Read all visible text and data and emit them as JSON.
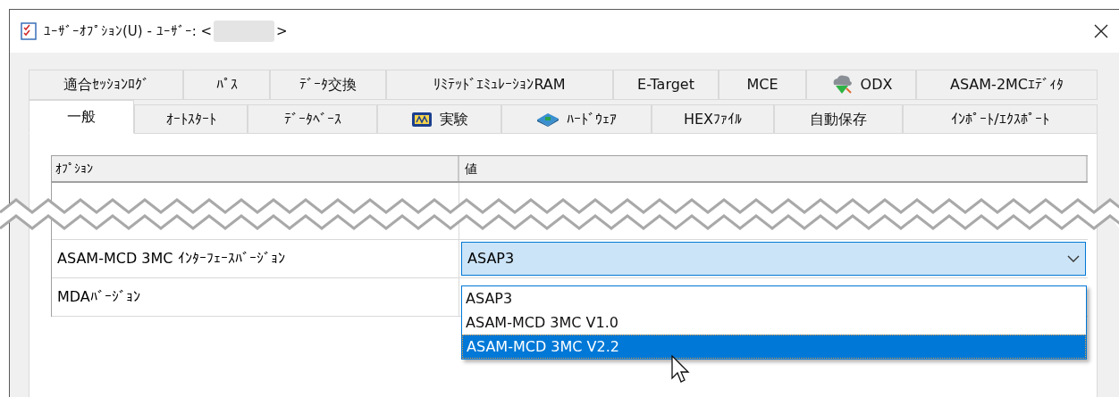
{
  "window": {
    "title_prefix": "ﾕｰｻﾞｰｵﾌﾟｼｮﾝ(U) - ﾕｰｻﾞｰ: <",
    "title_suffix": ">"
  },
  "tabs_back": [
    {
      "label": "適合ｾｯｼｮﾝﾛｸﾞ",
      "kind": "text",
      "selected": false
    },
    {
      "label": "ﾊﾟｽ",
      "kind": "text",
      "selected": false
    },
    {
      "label": "ﾃﾞｰﾀ交換",
      "kind": "text",
      "selected": false
    },
    {
      "label": "ﾘﾐﾃｯﾄﾞｴﾐｭﾚｰｼｮﾝRAM",
      "kind": "text",
      "selected": false
    },
    {
      "label": "E-Target",
      "kind": "text",
      "selected": false
    },
    {
      "label": "MCE",
      "kind": "text",
      "selected": false
    },
    {
      "label": "ODX",
      "kind": "odx",
      "selected": false
    },
    {
      "label": "ASAM-2MCｴﾃﾞｨﾀ",
      "kind": "text",
      "selected": false
    }
  ],
  "tabs_front": [
    {
      "label": "一般",
      "kind": "text",
      "selected": true
    },
    {
      "label": "ｵｰﾄｽﾀｰﾄ",
      "kind": "text",
      "selected": false
    },
    {
      "label": "ﾃﾞｰﾀﾍﾞｰｽ",
      "kind": "text",
      "selected": false
    },
    {
      "label": "実験",
      "kind": "experiment",
      "selected": false
    },
    {
      "label": "ﾊｰﾄﾞｳｪｱ",
      "kind": "hardware",
      "selected": false
    },
    {
      "label": "HEXﾌｧｲﾙ",
      "kind": "text",
      "selected": false
    },
    {
      "label": "自動保存",
      "kind": "text",
      "selected": false
    },
    {
      "label": "ｲﾝﾎﾟｰﾄ/ｴｸｽﾎﾟｰﾄ",
      "kind": "text",
      "selected": false
    }
  ],
  "table": {
    "columns": [
      "ｵﾌﾟｼｮﾝ",
      "値"
    ],
    "rows": [
      {
        "option": "ASAM-MCD 3MC ｲﾝﾀｰﾌｪｰｽﾊﾞｰｼﾞｮﾝ",
        "kind": "combo",
        "value": "ASAP3"
      },
      {
        "option": "MDAﾊﾞｰｼﾞｮﾝ",
        "kind": "text"
      }
    ]
  },
  "dropdown": [
    {
      "label": "ASAP3",
      "selected": false
    },
    {
      "label": "ASAM-MCD 3MC V1.0",
      "selected": false
    },
    {
      "label": "ASAM-MCD 3MC V2.2",
      "selected": true
    }
  ]
}
